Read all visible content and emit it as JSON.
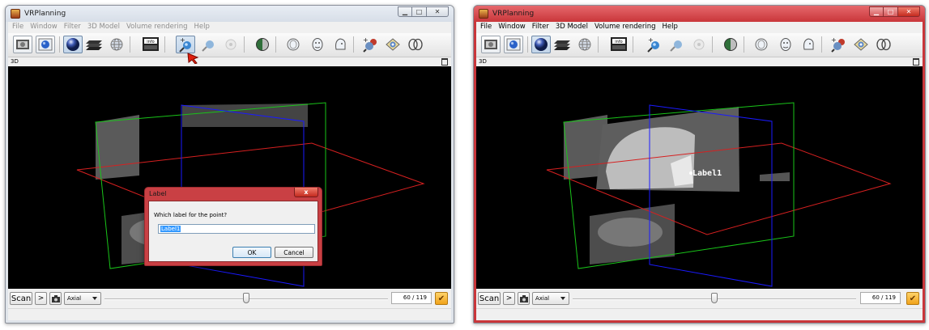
{
  "app": {
    "title": "VRPlanning",
    "menu": [
      "File",
      "Window",
      "Filter",
      "3D Model",
      "Volume rendering",
      "Help"
    ],
    "view_name": "3D"
  },
  "toolbar": {
    "buttons": [
      {
        "name": "open-dicom-button",
        "icon": "folder-scan-icon"
      },
      {
        "name": "open-model-button",
        "icon": "globe-icon"
      },
      {
        "name": "sphere-render-button",
        "icon": "sphere-icon"
      },
      {
        "name": "slices-button",
        "icon": "slices-icon"
      },
      {
        "name": "wire-sphere-button",
        "icon": "wire-sphere-icon"
      },
      {
        "name": "info-button",
        "icon": "info-icon",
        "text": "info"
      },
      {
        "name": "add-point-button",
        "icon": "add-point-icon"
      },
      {
        "name": "move-point-button",
        "icon": "move-point-icon"
      },
      {
        "name": "delete-point-button",
        "icon": "delete-point-icon"
      },
      {
        "name": "opacity-button",
        "icon": "half-sphere-icon"
      },
      {
        "name": "organ-button",
        "icon": "organ-icon"
      },
      {
        "name": "face-button",
        "icon": "face-icon"
      },
      {
        "name": "head-button",
        "icon": "head-icon"
      },
      {
        "name": "tools-button",
        "icon": "tools-icon"
      },
      {
        "name": "camera-button",
        "icon": "eye-camera-icon"
      },
      {
        "name": "stereo-button",
        "icon": "stereo-icon"
      }
    ]
  },
  "dialog": {
    "title": "Label",
    "close": "x",
    "question": "Which label for the point?",
    "value": "Label1",
    "ok": "OK",
    "cancel": "Cancel"
  },
  "overlay_label": "Label1",
  "bottom": {
    "scan_label": "Scan",
    "play_label": ">",
    "orientation": "Axial",
    "slice_counter": "60 / 119",
    "slider_position": 0.5
  },
  "colors": {
    "axial_plane": "#d62020",
    "sagittal_plane": "#1a1aff",
    "coronal_plane": "#19c419",
    "active_window_frame": "#c9363a"
  }
}
